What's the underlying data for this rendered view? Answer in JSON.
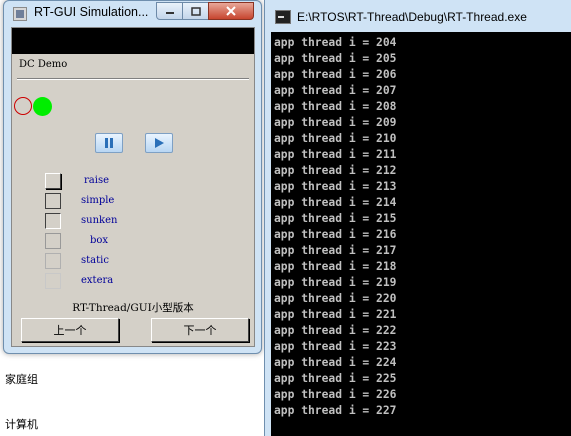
{
  "gui_window": {
    "title": "RT-GUI Simulation...",
    "dc_label": "DC Demo",
    "styles": [
      "raise",
      "simple",
      "sunken",
      "box",
      "static",
      "extera"
    ],
    "footer": "RT-Thread/GUI小型版本",
    "prev_label": "上一个",
    "next_label": "下一个"
  },
  "desktop": {
    "items": [
      "家庭组",
      "计算机"
    ]
  },
  "console": {
    "title": "E:\\RTOS\\RT-Thread\\Debug\\RT-Thread.exe",
    "lines": [
      "app thread i = 204",
      "app thread i = 205",
      "app thread i = 206",
      "app thread i = 207",
      "app thread i = 208",
      "app thread i = 209",
      "app thread i = 210",
      "app thread i = 211",
      "app thread i = 212",
      "app thread i = 213",
      "app thread i = 214",
      "app thread i = 215",
      "app thread i = 216",
      "app thread i = 217",
      "app thread i = 218",
      "app thread i = 219",
      "app thread i = 220",
      "app thread i = 221",
      "app thread i = 222",
      "app thread i = 223",
      "app thread i = 224",
      "app thread i = 225",
      "app thread i = 226",
      "app thread i = 227"
    ]
  },
  "colors": {
    "console_bg": "#000000",
    "console_text": "#c0c0c0",
    "gui_face": "#d4d0c8",
    "style_label": "#000099",
    "circle_red": "#cc0000",
    "circle_green": "#00ee00"
  },
  "icons": [
    "app-icon",
    "minimize-icon",
    "maximize-icon",
    "close-icon",
    "pause-icon",
    "play-icon",
    "console-icon"
  ]
}
